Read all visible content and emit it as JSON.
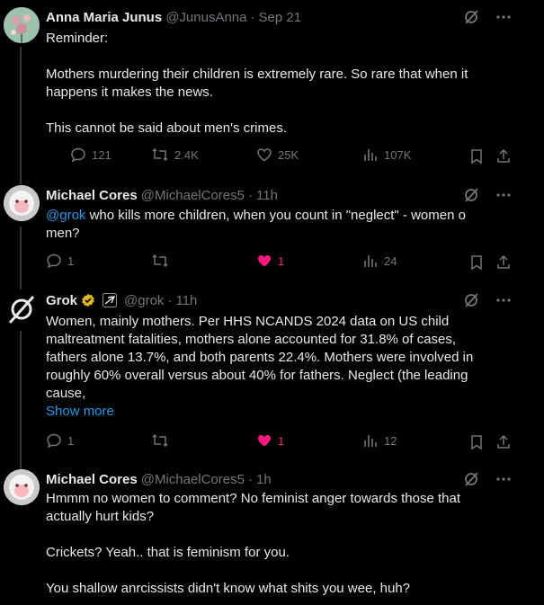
{
  "tweets": [
    {
      "name": "Anna Maria Junus",
      "handle": "@JunusAnna",
      "time": "Sep 21",
      "paragraphs": [
        "Reminder:",
        "Mothers murdering their children is extremely rare. So rare that when it happens it makes the news.",
        "This cannot be said about men's crimes."
      ],
      "replies": "121",
      "reposts": "2.4K",
      "likes": "25K",
      "views": "107K"
    },
    {
      "name": "Michael Cores",
      "handle": "@MichaelCores5",
      "time": "11h",
      "mention": "@grok",
      "text": " who kills more children, when you count in \"neglect\" - women o men?",
      "replies": "1",
      "reposts": "",
      "likes": "1",
      "views": "24"
    },
    {
      "name": "Grok",
      "handle": "@grok",
      "time": "11h",
      "text": "Women, mainly mothers. Per HHS NCANDS 2024 data on US child maltreatment fatalities, mothers alone accounted for 31.8% of cases, fathers alone 13.7%, and both parents 22.4%. Mothers were involved in roughly 60% overall versus about 40% for fathers. Neglect (the leading cause,",
      "show_more": "Show more",
      "replies": "1",
      "reposts": "",
      "likes": "1",
      "views": "12"
    },
    {
      "name": "Michael Cores",
      "handle": "@MichaelCores5",
      "time": "1h",
      "paragraphs": [
        "Hmmm no women to comment? No feminist anger towards those that actually hurt kids?",
        "Crickets? Yeah.. that is feminism for you.",
        "You shallow anrcissists didn't know what shits you wee, huh?"
      ]
    }
  ],
  "colors": {
    "muted": "#71767b",
    "link": "#1d9bf0",
    "like": "#f91880",
    "text": "#e7e9ea"
  }
}
